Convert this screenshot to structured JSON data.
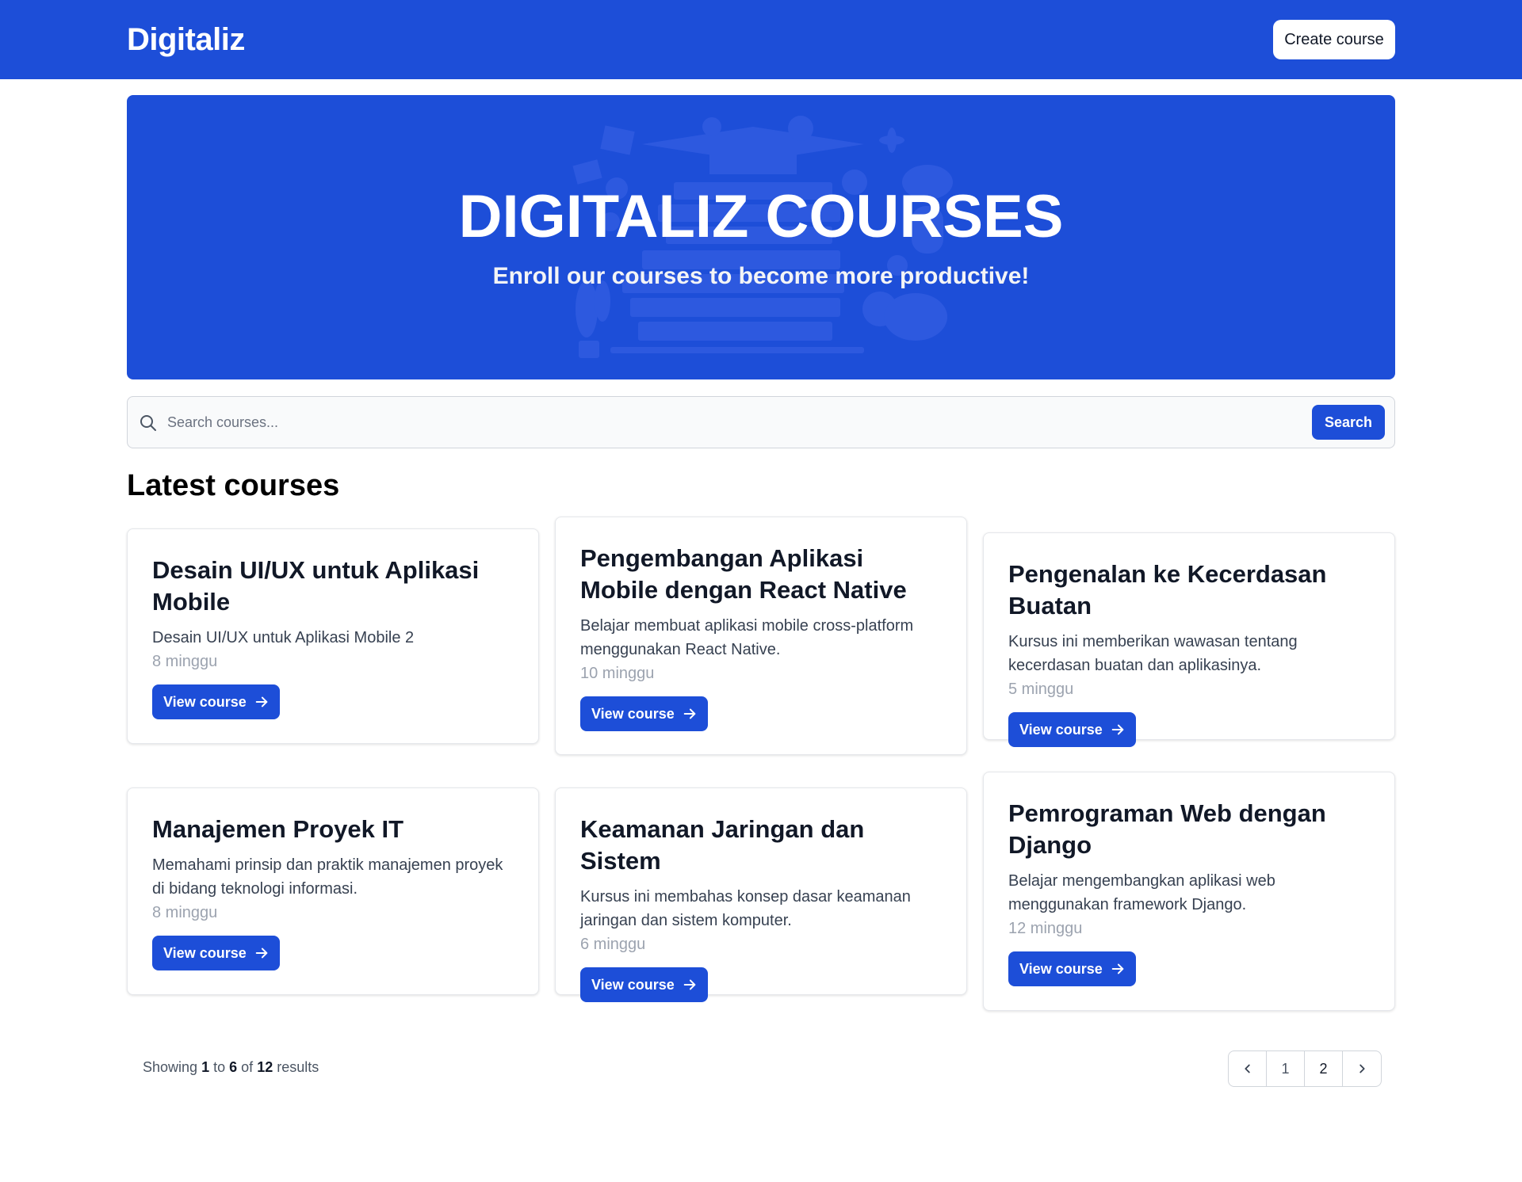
{
  "navbar": {
    "brand": "Digitaliz",
    "create_button": "Create course"
  },
  "hero": {
    "title": "DIGITALIZ COURSES",
    "subtitle": "Enroll our courses to become more productive!"
  },
  "search": {
    "placeholder": "Search courses...",
    "value": "",
    "button_label": "Search"
  },
  "section_title": "Latest courses",
  "courses": [
    {
      "title": "Desain UI/UX untuk Aplikasi Mobile",
      "description": "Desain UI/UX untuk Aplikasi Mobile 2",
      "duration": "8 minggu",
      "button_label": "View course"
    },
    {
      "title": "Pengembangan Aplikasi Mobile dengan React Native",
      "description": "Belajar membuat aplikasi mobile cross-platform menggunakan React Native.",
      "duration": "10 minggu",
      "button_label": "View course"
    },
    {
      "title": "Pengenalan ke Kecerdasan Buatan",
      "description": "Kursus ini memberikan wawasan tentang kecerdasan buatan dan aplikasinya.",
      "duration": "5 minggu",
      "button_label": "View course"
    },
    {
      "title": "Manajemen Proyek IT",
      "description": "Memahami prinsip dan praktik manajemen proyek di bidang teknologi informasi.",
      "duration": "8 minggu",
      "button_label": "View course"
    },
    {
      "title": "Keamanan Jaringan dan Sistem",
      "description": "Kursus ini membahas konsep dasar keamanan jaringan dan sistem komputer.",
      "duration": "6 minggu",
      "button_label": "View course"
    },
    {
      "title": "Pemrograman Web dengan Django",
      "description": "Belajar mengembangkan aplikasi web menggunakan framework Django.",
      "duration": "12 minggu",
      "button_label": "View course"
    }
  ],
  "pagination": {
    "showing_prefix": "Showing",
    "from": "1",
    "to_word": "to",
    "to": "6",
    "of_word": "of",
    "total": "12",
    "results_word": "results",
    "pages": [
      "1",
      "2"
    ]
  },
  "colors": {
    "primary": "#1d4ed8",
    "background": "#ffffff",
    "muted_text": "#9ca3af"
  },
  "icons": {
    "search": "search-icon",
    "arrow": "arrow-right-icon",
    "prev": "chevron-left-icon",
    "next": "chevron-right-icon"
  }
}
